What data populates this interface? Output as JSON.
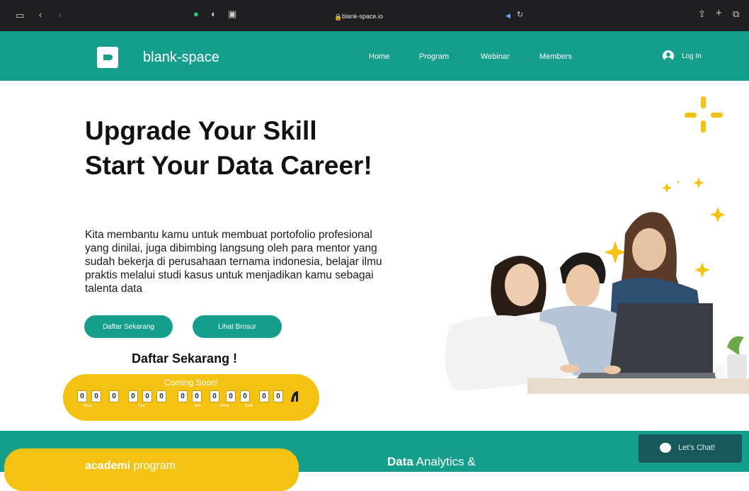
{
  "browser": {
    "url": "blank-space.io",
    "icons": [
      "sidebar-icon",
      "back-icon",
      "forward-icon",
      "extension-icon",
      "privacy-icon",
      "tab-icon",
      "lock-icon",
      "audio-icon",
      "reload-icon",
      "share-icon",
      "new-tab-icon",
      "tabs-overview-icon"
    ]
  },
  "nav": {
    "brand": "blank-space",
    "links": [
      "Home",
      "Program",
      "Webinar",
      "Members"
    ],
    "login": "Log In"
  },
  "hero": {
    "title": "Upgrade Your Skill Start Your Data Career!",
    "description": "Kita membantu kamu untuk membuat portofolio profesional yang dinilai, juga dibimbing langsung oleh para mentor yang sudah bekerja di perusahaan ternama indonesia, belajar ilmu praktis melalui studi kasus untuk menjadikan kamu sebagai talenta data",
    "btn_primary": "Daftar Sekarang",
    "btn_secondary": "Lihat Brosur",
    "cta": "Daftar Sekarang !"
  },
  "countdown": {
    "title": "Coming Soon!",
    "digits": [
      "0",
      "0",
      "0",
      "0",
      "0",
      "0",
      "0",
      "0",
      "0",
      "0",
      "0",
      "0"
    ],
    "units": [
      "Years",
      "Hari",
      "Jam",
      "Menit",
      "Detik"
    ]
  },
  "bottom": {
    "academi_bold": "academi",
    "academi_rest": "program",
    "analytics_bold": "Data",
    "analytics_rest": "Analytics &"
  },
  "chat": {
    "label": "Let's Chat!"
  },
  "colors": {
    "teal": "#159e8c",
    "yellow": "#f3c213",
    "dark_chat": "#17595b"
  }
}
